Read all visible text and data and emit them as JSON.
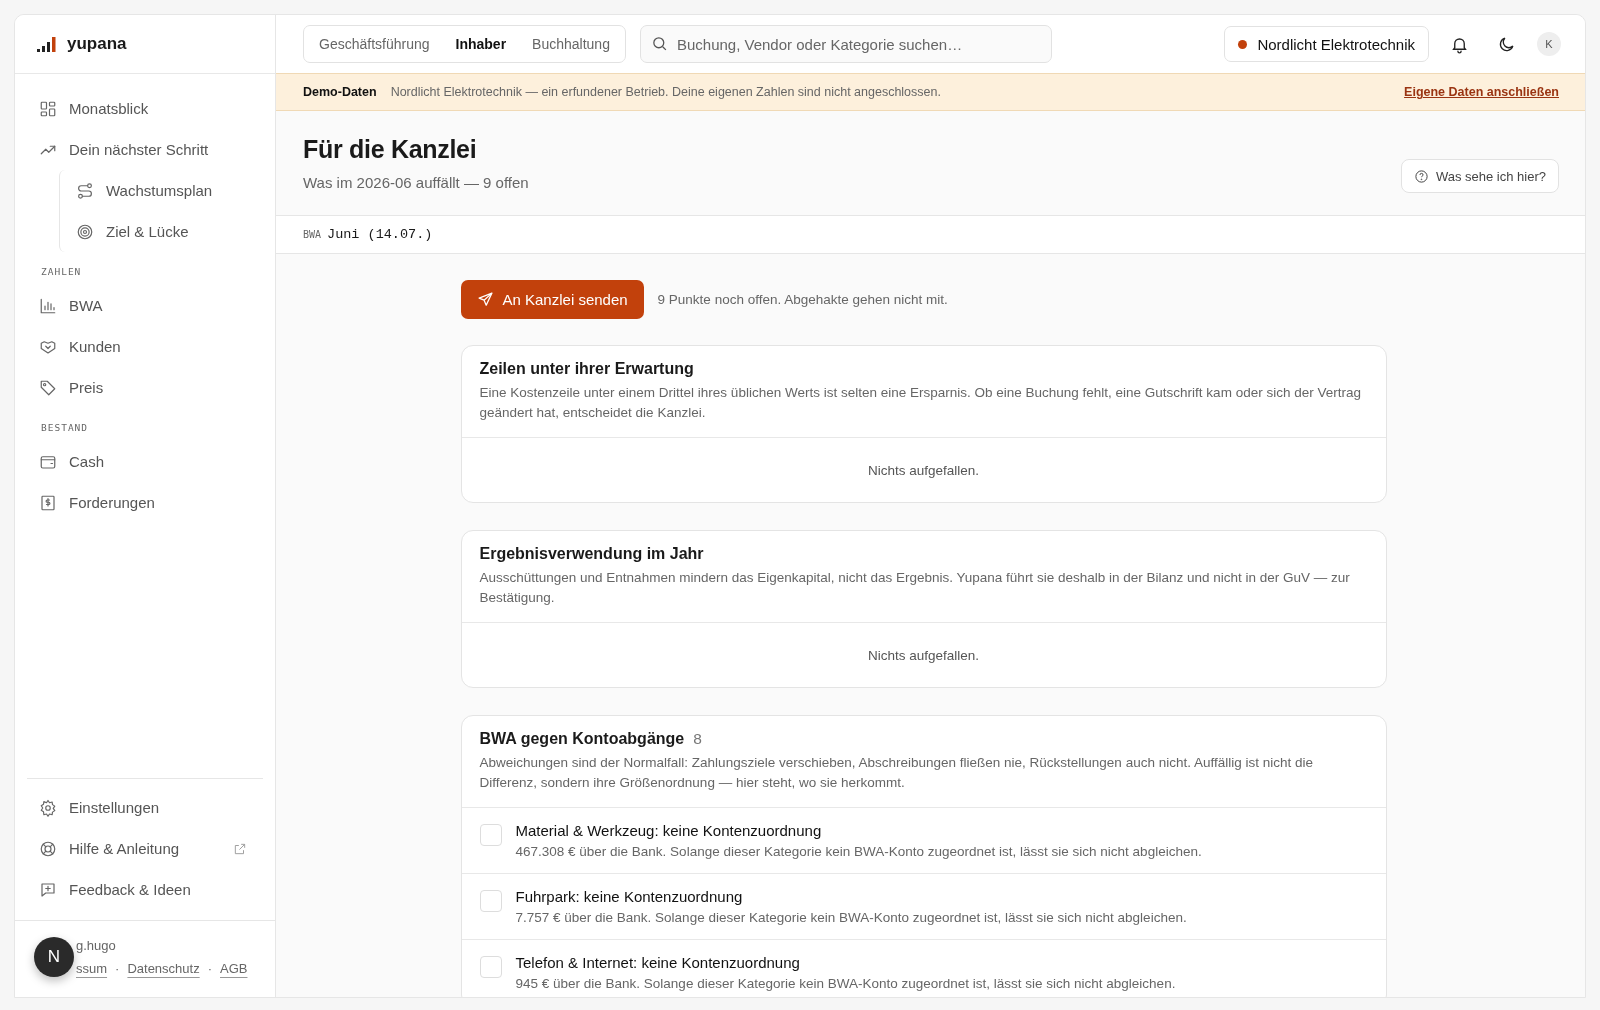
{
  "brand": {
    "name": "yupana"
  },
  "sidebar": {
    "sections": [
      {
        "items": [
          {
            "label": "Monatsblick"
          },
          {
            "label": "Dein nächster Schritt",
            "children": [
              {
                "label": "Wachstumsplan"
              },
              {
                "label": "Ziel & Lücke"
              }
            ]
          }
        ]
      },
      {
        "heading": "ZAHLEN",
        "items": [
          {
            "label": "BWA"
          },
          {
            "label": "Kunden"
          },
          {
            "label": "Preis"
          }
        ]
      },
      {
        "heading": "BESTAND",
        "items": [
          {
            "label": "Cash"
          },
          {
            "label": "Forderungen"
          }
        ]
      }
    ],
    "footer_items": [
      {
        "label": "Einstellungen",
        "external": false
      },
      {
        "label": "Hilfe & Anleitung",
        "external": true
      },
      {
        "label": "Feedback & Ideen",
        "external": false
      }
    ],
    "credit": "g.hugo",
    "links": [
      "ssum",
      "Datenschutz",
      "AGB"
    ],
    "separator": "·"
  },
  "dev_badge": "N",
  "topbar": {
    "tabs": [
      {
        "label": "Geschäftsführung",
        "selected": false
      },
      {
        "label": "Inhaber",
        "selected": true
      },
      {
        "label": "Buchhaltung",
        "selected": false
      }
    ],
    "search": {
      "placeholder": "Buchung, Vendor oder Kategorie suchen…"
    },
    "company": {
      "name": "Nordlicht Elektrotechnik",
      "color": "#c2410c"
    },
    "avatar": "K"
  },
  "banner": {
    "label": "Demo-Daten",
    "text": "Nordlicht Elektrotechnik — ein erfundener Betrieb. Deine eigenen Zahlen sind nicht angeschlossen.",
    "link": "Eigene Daten anschließen"
  },
  "header": {
    "title": "Für die Kanzlei",
    "subtitle": "Was im 2026-06 auffällt — 9 offen",
    "help_button": "Was sehe ich hier?"
  },
  "period": {
    "tag": "BWA",
    "value": "Juni (14.07.)"
  },
  "action": {
    "button": "An Kanzlei senden",
    "note": "9 Punkte noch offen. Abgehakte gehen nicht mit."
  },
  "cards": [
    {
      "title": "Zeilen unter ihrer Erwartung",
      "description": "Eine Kostenzeile unter einem Drittel ihres üblichen Werts ist selten eine Ersparnis. Ob eine Buchung fehlt, eine Gutschrift kam oder sich der Vertrag geändert hat, entscheidet die Kanzlei.",
      "empty": "Nichts aufgefallen."
    },
    {
      "title": "Ergebnisverwendung im Jahr",
      "description": "Ausschüttungen und Entnahmen mindern das Eigenkapital, nicht das Ergebnis. Yupana führt sie deshalb in der Bilanz und nicht in der GuV — zur Bestätigung.",
      "empty": "Nichts aufgefallen."
    },
    {
      "title": "BWA gegen Kontoabgänge",
      "count": "8",
      "description": "Abweichungen sind der Normalfall: Zahlungsziele verschieben, Abschreibungen fließen nie, Rückstellungen auch nicht. Auffällig ist nicht die Differenz, sondern ihre Größenordnung — hier steht, wo sie herkommt.",
      "rows": [
        {
          "title": "Material & Werkzeug: keine Kontenzuordnung",
          "detail": "467.308 € über die Bank. Solange dieser Kategorie kein BWA-Konto zugeordnet ist, lässt sie sich nicht abgleichen.",
          "checked": false
        },
        {
          "title": "Fuhrpark: keine Kontenzuordnung",
          "detail": "7.757 € über die Bank. Solange dieser Kategorie kein BWA-Konto zugeordnet ist, lässt sie sich nicht abgleichen.",
          "checked": false
        },
        {
          "title": "Telefon & Internet: keine Kontenzuordnung",
          "detail": "945 € über die Bank. Solange dieser Kategorie kein BWA-Konto zugeordnet ist, lässt sie sich nicht abgleichen.",
          "checked": false
        }
      ]
    }
  ]
}
